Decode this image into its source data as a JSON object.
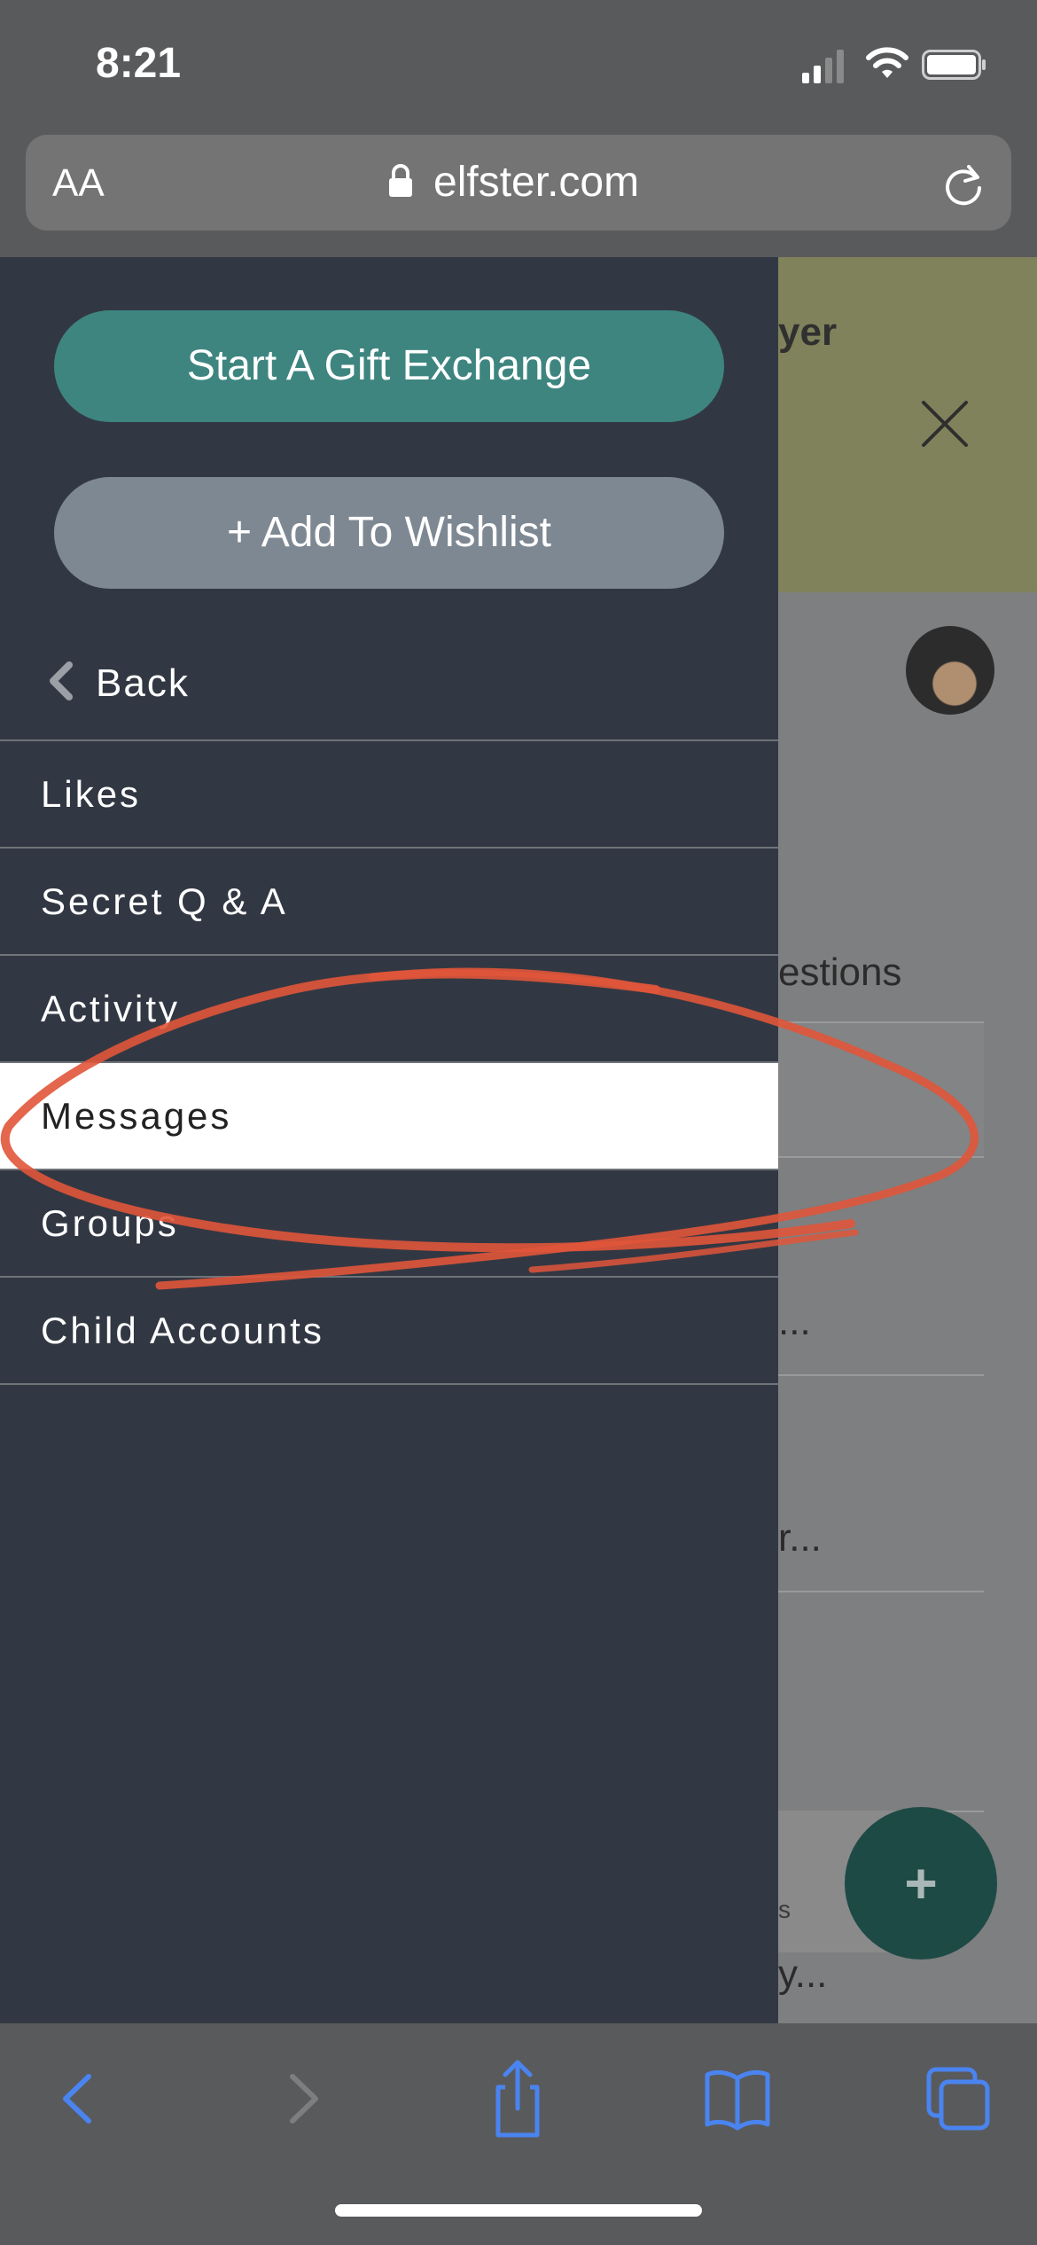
{
  "status_bar": {
    "time": "8:21",
    "icons": [
      "cellular-signal-icon",
      "wifi-icon",
      "battery-icon"
    ]
  },
  "url_bar": {
    "text_size_label": "AA",
    "url": "elfster.com",
    "icons": [
      "lock-icon",
      "reload-icon"
    ]
  },
  "side_menu": {
    "primary_button": "Start A Gift Exchange",
    "secondary_button": "+ Add To Wishlist",
    "back_label": "Back",
    "items": [
      {
        "label": "Likes",
        "active": false
      },
      {
        "label": "Secret Q & A",
        "active": false
      },
      {
        "label": "Activity",
        "active": false
      },
      {
        "label": "Messages",
        "active": true
      },
      {
        "label": "Groups",
        "active": false
      },
      {
        "label": "Child Accounts",
        "active": false
      }
    ]
  },
  "page_behind": {
    "banner_text": "yer",
    "texts": [
      "estions",
      "...",
      "r...",
      "y..."
    ],
    "card_text": "s",
    "fab_label": "+"
  },
  "toolbar": {
    "icons": [
      "back-arrow-icon",
      "forward-arrow-icon",
      "share-icon",
      "bookmarks-icon",
      "tabs-icon"
    ]
  },
  "colors": {
    "menu_background": "#323843",
    "primary_button": "#3e8580",
    "secondary_button": "#7e8893",
    "annotation": "#e0553a",
    "safari_chrome": "#595a5c",
    "toolbar_icon": "#3b82f6"
  }
}
